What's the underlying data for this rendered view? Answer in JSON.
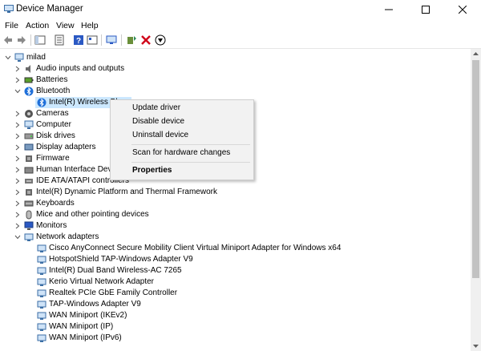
{
  "window": {
    "title": "Device Manager"
  },
  "menu": [
    "File",
    "Action",
    "View",
    "Help"
  ],
  "tree": {
    "root": "milad",
    "rows": [
      {
        "label": "Audio inputs and outputs",
        "icon": "speaker-icon"
      },
      {
        "label": "Batteries",
        "icon": "battery-icon"
      },
      {
        "label": "Bluetooth",
        "icon": "bluetooth-icon",
        "expanded": true
      },
      {
        "label": "Intel(R) Wireless Bl",
        "icon": "bluetooth-icon",
        "child": true,
        "selected": true
      },
      {
        "label": "Cameras",
        "icon": "camera-icon"
      },
      {
        "label": "Computer",
        "icon": "computer-icon"
      },
      {
        "label": "Disk drives",
        "icon": "disk-icon"
      },
      {
        "label": "Display adapters",
        "icon": "display-icon"
      },
      {
        "label": "Firmware",
        "icon": "chip-icon"
      },
      {
        "label": "Human Interface Devic",
        "icon": "hid-icon"
      },
      {
        "label": "IDE ATA/ATAPI controllers",
        "icon": "ide-icon"
      },
      {
        "label": "Intel(R) Dynamic Platform and Thermal Framework",
        "icon": "chip-icon"
      },
      {
        "label": "Keyboards",
        "icon": "keyboard-icon"
      },
      {
        "label": "Mice and other pointing devices",
        "icon": "mouse-icon"
      },
      {
        "label": "Monitors",
        "icon": "monitor-icon"
      },
      {
        "label": "Network adapters",
        "icon": "network-icon",
        "expanded": true
      },
      {
        "label": "Cisco AnyConnect Secure Mobility Client Virtual Miniport Adapter for Windows x64",
        "icon": "network-icon",
        "child": true
      },
      {
        "label": "HotspotShield TAP-Windows Adapter V9",
        "icon": "network-icon",
        "child": true
      },
      {
        "label": "Intel(R) Dual Band Wireless-AC 7265",
        "icon": "network-icon",
        "child": true
      },
      {
        "label": "Kerio Virtual Network Adapter",
        "icon": "network-icon",
        "child": true
      },
      {
        "label": "Realtek PCIe GbE Family Controller",
        "icon": "network-icon",
        "child": true
      },
      {
        "label": "TAP-Windows Adapter V9",
        "icon": "network-icon",
        "child": true
      },
      {
        "label": "WAN Miniport (IKEv2)",
        "icon": "network-icon",
        "child": true
      },
      {
        "label": "WAN Miniport (IP)",
        "icon": "network-icon",
        "child": true
      },
      {
        "label": "WAN Miniport (IPv6)",
        "icon": "network-icon",
        "child": true
      }
    ]
  },
  "context_menu": {
    "update": "Update driver",
    "disable": "Disable device",
    "uninstall": "Uninstall device",
    "scan": "Scan for hardware changes",
    "properties": "Properties"
  },
  "colors": {
    "selection": "#cce8ff",
    "disable_icon": "#d0021b",
    "bluetooth": "#1e6fd9"
  }
}
